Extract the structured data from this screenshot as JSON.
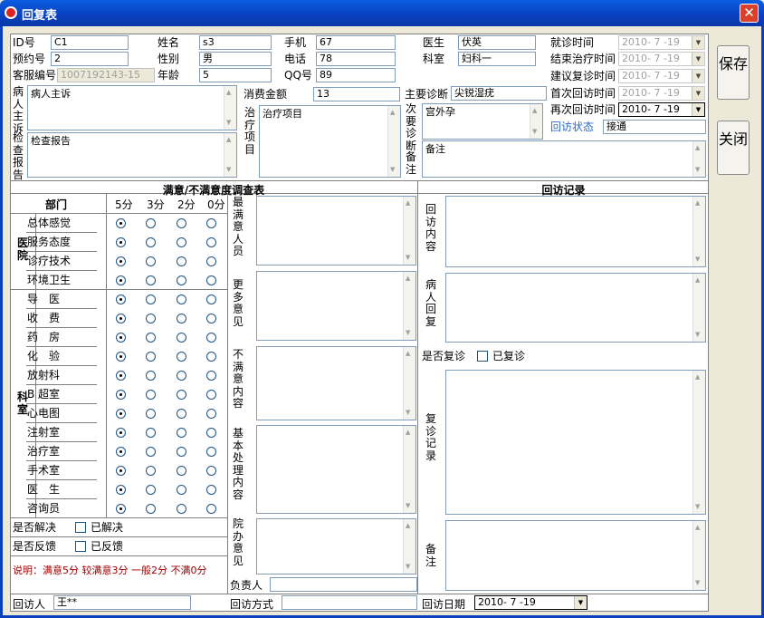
{
  "window": {
    "title": "回复表",
    "close_glyph": "✕"
  },
  "buttons": {
    "save": "保存",
    "close": "关闭"
  },
  "info": {
    "id_label": "ID号",
    "id_value": "C1",
    "name_label": "姓名",
    "name_value": "s3",
    "mobile_label": "手机",
    "mobile_value": "67",
    "doctor_label": "医生",
    "doctor_value": "伏英",
    "visit_time_label": "就诊时间",
    "visit_time_value": "2010- 7 -19",
    "appt_label": "预约号",
    "appt_value": "2",
    "gender_label": "性别",
    "gender_value": "男",
    "phone_label": "电话",
    "phone_value": "78",
    "dept_label": "科室",
    "dept_value": "妇科一",
    "end_time_label": "结束治疗时间",
    "end_time_value": "2010- 7 -19",
    "cs_label": "客服编号",
    "cs_value": "1007192143-15",
    "age_label": "年龄",
    "age_value": "5",
    "qq_label": "QQ号",
    "qq_value": "89",
    "suggest_label": "建议复诊时间",
    "suggest_value": "2010- 7 -19",
    "first_label": "首次回访时间",
    "first_value": "2010- 7 -19",
    "second_label": "再次回访时间",
    "second_value": "2010- 7 -19",
    "status_label": "回访状态",
    "status_value": "接通",
    "complaint_label": "病人主诉",
    "complaint_value": "病人主诉",
    "report_label": "检查报告",
    "report_value": "检查报告",
    "amount_label": "消费金额",
    "amount_value": "13",
    "treat_label": "治疗项目",
    "treat_value": "治疗项目",
    "main_diag_label": "主要诊断",
    "main_diag_value": "尖锐湿疣",
    "sec_diag_label": "次要诊断",
    "sec_diag_value": "宫外孕",
    "remark_label": "备注",
    "remark_value": "备注"
  },
  "survey": {
    "title": "满意/不满意度调查表",
    "col_dept": "部门",
    "scores": [
      "5分",
      "3分",
      "2分",
      "0分"
    ],
    "group_hospital": "医院",
    "group_dept": "科室",
    "rows": [
      "总体感觉",
      "服务态度",
      "诊疗技术",
      "环境卫生",
      "导　医",
      "收　费",
      "药　房",
      "化　验",
      "放射科",
      "B 超室",
      "心电图",
      "注射室",
      "治疗室",
      "手术室",
      "医　生",
      "咨询员"
    ],
    "resolved_label": "是否解决",
    "resolved_check": "已解决",
    "feedback_label": "是否反馈",
    "feedback_check": "已反馈",
    "note": "说明：满意5分 较满意3分 一般2分 不满0分",
    "best_staff": "最满意人员",
    "more_opinion": "更多意见",
    "unsat": "不满意内容",
    "handling": "基本处理内容",
    "hospital_opinion": "院办意见",
    "owner": "负责人"
  },
  "record": {
    "title": "回访记录",
    "content": "回访内容",
    "reply": "病人回复",
    "revisit_label": "是否复诊",
    "revisit_check": "已复诊",
    "revisit_record": "复诊记录",
    "remark": "备注"
  },
  "bottom": {
    "visitor_label": "回访人",
    "visitor_value": "王**",
    "method_label": "回访方式",
    "method_value": "",
    "date_label": "回访日期",
    "date_value": "2010- 7 -19"
  }
}
